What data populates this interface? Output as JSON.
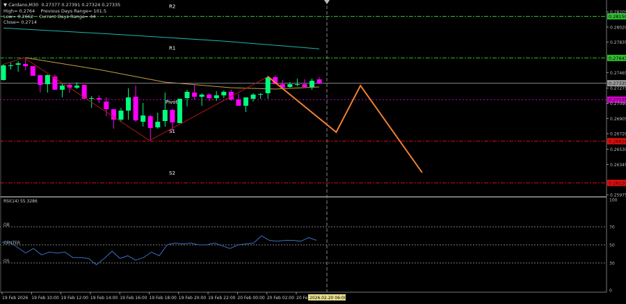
{
  "header": {
    "symbol_line": "Cardano,M30  0.27377 0.27391 0.27324 0.27335",
    "line2": "High= 0.2764    Previous Days Range= 101.5",
    "line3": "Low= 0.2662    Current Days Range= 44",
    "line4": "Close= 0.2714"
  },
  "colors": {
    "background": "#000000",
    "bull": "#00ff7f",
    "bear": "#ff00ff",
    "resistance": "#2fbf2f",
    "support": "#e01010",
    "pivot": "#d000d0",
    "ma_slow": "#1fb5b0",
    "ma_fast": "#c8a040",
    "zigzag": "#b01818",
    "forecast": "#f08030",
    "rsi": "#3a6fc0"
  },
  "levels": [
    {
      "name": "R2",
      "price": 0.2815,
      "tag": "0.28150",
      "kind": "resistance"
    },
    {
      "name": "R1",
      "price": 0.27643,
      "tag": "0.27643",
      "kind": "resistance"
    },
    {
      "name": "Pivot",
      "price": 0.27135,
      "tag": "0.27135",
      "kind": "pivot"
    },
    {
      "name": "S1",
      "price": 0.26628,
      "tag": "0.26628",
      "kind": "support"
    },
    {
      "name": "S2",
      "price": 0.2612,
      "tag": "0.26120",
      "kind": "support"
    }
  ],
  "current_price": {
    "price": 0.27335,
    "tag": "0.27335"
  },
  "price_axis": [
    "0.28205",
    "0.28020",
    "0.27835",
    "0.27465",
    "0.27275",
    "0.27090",
    "0.26905",
    "0.26720",
    "0.26530",
    "0.26345",
    "0.25975"
  ],
  "time_axis": [
    "19 Feb 2026",
    "19 Feb 10:00",
    "19 Feb 12:00",
    "19 Feb 14:00",
    "19 Feb 16:00",
    "19 Feb 18:00",
    "19 Feb 20:00",
    "19 Feb 22:00",
    "20 Feb 00:00",
    "20 Feb 02:00",
    "20 Fe"
  ],
  "time_cursor": "2026.02.20 06:00",
  "chart_data": {
    "type": "candlestick",
    "timeframe": "M30",
    "ylim": [
      0.25975,
      0.28205
    ],
    "ohlc": [
      [
        0.27374,
        0.27569,
        0.27365,
        0.27552
      ],
      [
        0.27552,
        0.27586,
        0.27501,
        0.27552
      ],
      [
        0.2756,
        0.27603,
        0.27476,
        0.27577
      ],
      [
        0.27569,
        0.27637,
        0.27492,
        0.27543
      ],
      [
        0.27543,
        0.27543,
        0.27425,
        0.27425
      ],
      [
        0.27433,
        0.27433,
        0.27221,
        0.27314
      ],
      [
        0.27323,
        0.27442,
        0.27221,
        0.27433
      ],
      [
        0.27416,
        0.27442,
        0.27255,
        0.27255
      ],
      [
        0.27255,
        0.27331,
        0.27162,
        0.27306
      ],
      [
        0.27314,
        0.27331,
        0.27221,
        0.2728
      ],
      [
        0.2728,
        0.27348,
        0.27264,
        0.27306
      ],
      [
        0.27314,
        0.27314,
        0.27145,
        0.27145
      ],
      [
        0.27145,
        0.27179,
        0.27035,
        0.27153
      ],
      [
        0.27153,
        0.27187,
        0.27094,
        0.27136
      ],
      [
        0.27111,
        0.27162,
        0.26933,
        0.27018
      ],
      [
        0.27018,
        0.27018,
        0.2678,
        0.26891
      ],
      [
        0.26891,
        0.27035,
        0.26865,
        0.27001
      ],
      [
        0.27001,
        0.27272,
        0.26891,
        0.27162
      ],
      [
        0.2717,
        0.27306,
        0.26865,
        0.26882
      ],
      [
        0.26865,
        0.27094,
        0.26806,
        0.26942
      ],
      [
        0.26933,
        0.2695,
        0.26636,
        0.26789
      ],
      [
        0.26797,
        0.26975,
        0.2678,
        0.26865
      ],
      [
        0.26874,
        0.27221,
        0.26806,
        0.27009
      ],
      [
        0.27009,
        0.27026,
        0.26746,
        0.26857
      ],
      [
        0.26848,
        0.27145,
        0.26848,
        0.27145
      ],
      [
        0.27153,
        0.27255,
        0.27052,
        0.2723
      ],
      [
        0.27221,
        0.27314,
        0.27136,
        0.2717
      ],
      [
        0.2717,
        0.27213,
        0.2706,
        0.27196
      ],
      [
        0.27196,
        0.27213,
        0.27119,
        0.27153
      ],
      [
        0.27153,
        0.27238,
        0.27119,
        0.27187
      ],
      [
        0.27187,
        0.27247,
        0.27153,
        0.2723
      ],
      [
        0.2723,
        0.27255,
        0.27119,
        0.27136
      ],
      [
        0.27136,
        0.27204,
        0.2706,
        0.2706
      ],
      [
        0.2706,
        0.27162,
        0.26984,
        0.27162
      ],
      [
        0.27145,
        0.27213,
        0.27111,
        0.27196
      ],
      [
        0.27196,
        0.27213,
        0.27145,
        0.27204
      ],
      [
        0.27213,
        0.27425,
        0.27145,
        0.27408
      ],
      [
        0.27408,
        0.27425,
        0.27323,
        0.27323
      ],
      [
        0.27323,
        0.27374,
        0.2728,
        0.2728
      ],
      [
        0.27289,
        0.27348,
        0.2728,
        0.27323
      ],
      [
        0.27323,
        0.27391,
        0.27297,
        0.27323
      ],
      [
        0.27323,
        0.27382,
        0.2728,
        0.27289
      ],
      [
        0.27289,
        0.27391,
        0.27255,
        0.27365
      ],
      [
        0.27382,
        0.27408,
        0.27323,
        0.27335
      ]
    ],
    "ma_slow": [
      [
        0,
        0.28008
      ],
      [
        15,
        0.27933
      ],
      [
        30,
        0.27848
      ],
      [
        43,
        0.27754
      ]
    ],
    "ma_fast": [
      [
        3,
        0.27645
      ],
      [
        13,
        0.27501
      ],
      [
        22,
        0.27348
      ],
      [
        31,
        0.2728
      ],
      [
        37,
        0.27264
      ],
      [
        43,
        0.27289
      ]
    ],
    "zigzag": [
      [
        -0.2,
        0.2756
      ],
      [
        2.8,
        0.27645
      ],
      [
        19.9,
        0.26636
      ],
      [
        36,
        0.27416
      ]
    ],
    "forecast": [
      [
        36,
        0.27416
      ],
      [
        45.3,
        0.26738
      ],
      [
        48.6,
        0.27306
      ],
      [
        57,
        0.26246
      ]
    ],
    "rsi": {
      "label": "RSI(14) 55.3286",
      "ylim": [
        0,
        100
      ],
      "levels": [
        {
          "name": "OB",
          "value": 70
        },
        {
          "name": "CENTER",
          "value": 50
        },
        {
          "name": "OS",
          "value": 30
        }
      ],
      "axis": [
        "100",
        "70",
        "50",
        "30",
        "0"
      ],
      "values": [
        53,
        53,
        47,
        41,
        46,
        39,
        42,
        41,
        42,
        36,
        36,
        35,
        28,
        35,
        43,
        35,
        38,
        33,
        36,
        42,
        38,
        50,
        52,
        51,
        52,
        50,
        50,
        52,
        49,
        46,
        50,
        51,
        52,
        60,
        55,
        54,
        55,
        55,
        54,
        58,
        55
      ]
    }
  }
}
